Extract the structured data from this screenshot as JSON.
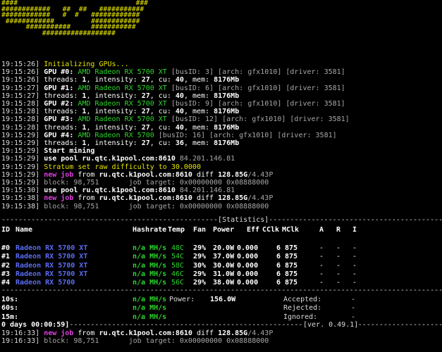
{
  "banner_lines": [
    "####                             ###",
    "############   ##  ##   ###########",
    "############   #  #   ############",
    " ############         ############",
    "      ###########     ###########",
    "          ##################"
  ],
  "log_lines": [
    {
      "time": "19:15:26]",
      "segments": [
        {
          "t": " Initializing GPUs...",
          "c": "y",
          "b": true
        }
      ]
    },
    {
      "time": "19:15:26]",
      "segments": [
        {
          "t": " GPU #0: ",
          "c": "wb"
        },
        {
          "t": "AMD Radeon RX 5700 XT",
          "c": "g"
        },
        {
          "t": " [busID: 3] [arch: gfx1010] [driver: 3581]",
          "c": "dim"
        }
      ]
    },
    {
      "time": "19:15:26]",
      "segments": [
        {
          "t": " threads: ",
          "c": "w"
        },
        {
          "t": "1",
          "c": "wb"
        },
        {
          "t": ", intensity: ",
          "c": "w"
        },
        {
          "t": "27",
          "c": "wb"
        },
        {
          "t": ", cu: ",
          "c": "w"
        },
        {
          "t": "40",
          "c": "wb"
        },
        {
          "t": ", mem: ",
          "c": "w"
        },
        {
          "t": "8176Mb",
          "c": "wb"
        }
      ]
    },
    {
      "time": "19:15:27]",
      "segments": [
        {
          "t": " GPU #1: ",
          "c": "wb"
        },
        {
          "t": "AMD Radeon RX 5700 XT",
          "c": "g"
        },
        {
          "t": " [busID: 6] [arch: gfx1010] [driver: 3581]",
          "c": "dim"
        }
      ]
    },
    {
      "time": "19:15:27]",
      "segments": [
        {
          "t": " threads: ",
          "c": "w"
        },
        {
          "t": "1",
          "c": "wb"
        },
        {
          "t": ", intensity: ",
          "c": "w"
        },
        {
          "t": "27",
          "c": "wb"
        },
        {
          "t": ", cu: ",
          "c": "w"
        },
        {
          "t": "40",
          "c": "wb"
        },
        {
          "t": ", mem: ",
          "c": "w"
        },
        {
          "t": "8176Mb",
          "c": "wb"
        }
      ]
    },
    {
      "time": "19:15:28]",
      "segments": [
        {
          "t": " GPU #2: ",
          "c": "wb"
        },
        {
          "t": "AMD Radeon RX 5700 XT",
          "c": "g"
        },
        {
          "t": " [busID: 9] [arch: gfx1010] [driver: 3581]",
          "c": "dim"
        }
      ]
    },
    {
      "time": "19:15:28]",
      "segments": [
        {
          "t": " threads: ",
          "c": "w"
        },
        {
          "t": "1",
          "c": "wb"
        },
        {
          "t": ", intensity: ",
          "c": "w"
        },
        {
          "t": "27",
          "c": "wb"
        },
        {
          "t": ", cu: ",
          "c": "w"
        },
        {
          "t": "40",
          "c": "wb"
        },
        {
          "t": ", mem: ",
          "c": "w"
        },
        {
          "t": "8176Mb",
          "c": "wb"
        }
      ]
    },
    {
      "time": "19:15:28]",
      "segments": [
        {
          "t": " GPU #3: ",
          "c": "wb"
        },
        {
          "t": "AMD Radeon RX 5700 XT",
          "c": "g"
        },
        {
          "t": " [busID: 12] [arch: gfx1010] [driver: 3581]",
          "c": "dim"
        }
      ]
    },
    {
      "time": "19:15:28]",
      "segments": [
        {
          "t": " threads: ",
          "c": "w"
        },
        {
          "t": "1",
          "c": "wb"
        },
        {
          "t": ", intensity: ",
          "c": "w"
        },
        {
          "t": "27",
          "c": "wb"
        },
        {
          "t": ", cu: ",
          "c": "w"
        },
        {
          "t": "40",
          "c": "wb"
        },
        {
          "t": ", mem: ",
          "c": "w"
        },
        {
          "t": "8176Mb",
          "c": "wb"
        }
      ]
    },
    {
      "time": "19:15:29]",
      "segments": [
        {
          "t": " GPU #4: ",
          "c": "wb"
        },
        {
          "t": "AMD Radeon RX 5700",
          "c": "g"
        },
        {
          "t": " [busID: 16] [arch: gfx1010] [driver: 3581]",
          "c": "dim"
        }
      ]
    },
    {
      "time": "19:15:29]",
      "segments": [
        {
          "t": " threads: ",
          "c": "w"
        },
        {
          "t": "1",
          "c": "wb"
        },
        {
          "t": ", intensity: ",
          "c": "w"
        },
        {
          "t": "27",
          "c": "wb"
        },
        {
          "t": ", cu: ",
          "c": "w"
        },
        {
          "t": "36",
          "c": "wb"
        },
        {
          "t": ", mem: ",
          "c": "w"
        },
        {
          "t": "8176Mb",
          "c": "wb"
        }
      ]
    },
    {
      "time": "19:15:29]",
      "segments": [
        {
          "t": " Start mining",
          "c": "wb"
        }
      ]
    },
    {
      "time": "19:15:29]",
      "segments": [
        {
          "t": " use pool ",
          "c": "wb"
        },
        {
          "t": "ru.qtc.k1pool.com:8610",
          "c": "wb"
        },
        {
          "t": " 84.201.146.81",
          "c": "dim"
        }
      ]
    },
    {
      "time": "19:15:29]",
      "segments": [
        {
          "t": " Stratum set raw difficulty to 30.0000",
          "c": "y"
        }
      ]
    },
    {
      "time": "19:15:29]",
      "segments": [
        {
          "t": " new job ",
          "c": "m"
        },
        {
          "t": "from ",
          "c": "w"
        },
        {
          "t": "ru.qtc.k1pool.com:8610",
          "c": "wb"
        },
        {
          "t": " diff ",
          "c": "w"
        },
        {
          "t": "128.85G",
          "c": "wb"
        },
        {
          "t": "/4.43P",
          "c": "dim"
        }
      ]
    },
    {
      "time": "19:15:29]",
      "segments": [
        {
          "t": " block: 98,751       job target: 0x00000000 0x08888000",
          "c": "dim"
        }
      ]
    },
    {
      "time": "19:15:30]",
      "segments": [
        {
          "t": " use pool ",
          "c": "wb"
        },
        {
          "t": "ru.qtc.k1pool.com:8610",
          "c": "wb"
        },
        {
          "t": " 84.201.146.81",
          "c": "dim"
        }
      ]
    },
    {
      "time": "19:15:38]",
      "segments": [
        {
          "t": " new job ",
          "c": "m"
        },
        {
          "t": "from ",
          "c": "w"
        },
        {
          "t": "ru.qtc.k1pool.com:8610",
          "c": "wb"
        },
        {
          "t": " diff ",
          "c": "w"
        },
        {
          "t": "128.85G",
          "c": "wb"
        },
        {
          "t": "/4.43P",
          "c": "dim"
        }
      ]
    },
    {
      "time": "19:15:38]",
      "segments": [
        {
          "t": " block: 98,751       job target: 0x00000000 0x08888000",
          "c": "dim"
        }
      ]
    }
  ],
  "stats": {
    "title_line": "---------------------------------------------------[Statistics]---------------------------------------------------",
    "headers": [
      "ID",
      "Name",
      "Hashrate",
      "Temp",
      "Fan",
      "Power",
      "Eff",
      "CClk",
      "MClk",
      "A",
      "R",
      "I"
    ],
    "rows": [
      {
        "id": "#0",
        "name": "Radeon RX 5700 XT",
        "hashrate": "n/a MH/s",
        "temp": "48C",
        "fan": "29%",
        "power": "20.0W",
        "eff": "0.000",
        "cclk": "6",
        "mclk": "875",
        "a": "-",
        "r": "-",
        "i": "-"
      },
      {
        "id": "#1",
        "name": "Radeon RX 5700 XT",
        "hashrate": "n/a MH/s",
        "temp": "54C",
        "fan": "29%",
        "power": "37.0W",
        "eff": "0.000",
        "cclk": "6",
        "mclk": "875",
        "a": "-",
        "r": "-",
        "i": "-"
      },
      {
        "id": "#2",
        "name": "Radeon RX 5700 XT",
        "hashrate": "n/a MH/s",
        "temp": "58C",
        "fan": "30%",
        "power": "30.0W",
        "eff": "0.000",
        "cclk": "6",
        "mclk": "875",
        "a": "-",
        "r": "-",
        "i": "-"
      },
      {
        "id": "#3",
        "name": "Radeon RX 5700 XT",
        "hashrate": "n/a MH/s",
        "temp": "46C",
        "fan": "29%",
        "power": "31.0W",
        "eff": "0.000",
        "cclk": "6",
        "mclk": "875",
        "a": "-",
        "r": "-",
        "i": "-"
      },
      {
        "id": "#4",
        "name": "Radeon RX 5700",
        "hashrate": "n/a MH/s",
        "temp": "56C",
        "fan": "29%",
        "power": "38.0W",
        "eff": "0.000",
        "cclk": "6",
        "mclk": "875",
        "a": "-",
        "r": "-",
        "i": "-"
      }
    ],
    "separator": "------------------------------------------------------------------------------------------------------------------",
    "summary": {
      "s10_label": "10s:",
      "s10_val": "n/a MH/s",
      "power_label": "Power:",
      "power_val": "156.0W",
      "accepted_label": "Accepted:",
      "accepted_val": "-",
      "s60_label": "60s:",
      "s60_val": "n/a MH/s",
      "rejected_label": "Rejected:",
      "rejected_val": "-",
      "m15_label": "15m:",
      "m15_val": "n/a MH/s",
      "ignored_label": "Ignored:",
      "ignored_val": "-"
    },
    "footer_left": "0 days 00:00:59]",
    "footer_dashes": "--------------------------------------------------------------------------------------------------",
    "footer_version": "[ver. 0.49.1]"
  },
  "tail_lines": [
    {
      "time": "19:16:33]",
      "segments": [
        {
          "t": " new job ",
          "c": "m"
        },
        {
          "t": "from ",
          "c": "w"
        },
        {
          "t": "ru.qtc.k1pool.com:8610",
          "c": "wb"
        },
        {
          "t": " diff ",
          "c": "w"
        },
        {
          "t": "128.85G",
          "c": "wb"
        },
        {
          "t": "/4.43P",
          "c": "dim"
        }
      ]
    },
    {
      "time": "19:16:33]",
      "segments": [
        {
          "t": " block: 98,751       job target: 0x00000000 0x08888000",
          "c": "dim"
        }
      ]
    }
  ],
  "colors": {
    "background": "#000000",
    "yellow": "#e6e600",
    "green": "#2bd62b",
    "magenta": "#e040e0",
    "blue": "#5b6cf0",
    "text": "#dcdcdc"
  }
}
